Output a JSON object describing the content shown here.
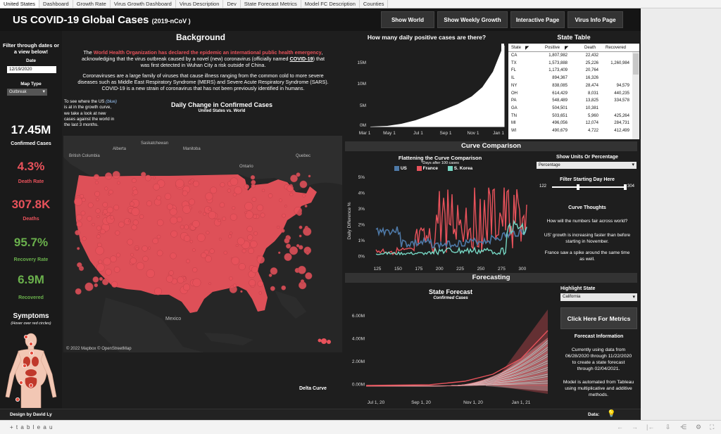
{
  "tabs": [
    "United States",
    "Dashboard",
    "Growth Rate",
    "Virus Growth Dashboard",
    "Virus Description",
    "Dev",
    "State Forecast Metrics",
    "Model FC Description",
    "Counties"
  ],
  "header": {
    "title": "US COVID-19 Global Cases",
    "subtitle": "(2019-nCoV )",
    "buttons": [
      "Show World",
      "Show Weekly Growth",
      "Interactive Page",
      "Virus Info Page"
    ]
  },
  "filters": {
    "heading_line1": "Filter through dates or",
    "heading_line2": "a view below!",
    "date_label": "Date",
    "date_value": "12/19/2020",
    "maptype_label": "Map Type",
    "maptype_value": "Outbreak"
  },
  "kpis": {
    "confirmed_value": "17.45M",
    "confirmed_label": "Confirmed Cases",
    "death_rate_value": "4.3%",
    "death_rate_label": "Death Rate",
    "deaths_value": "307.8K",
    "deaths_label": "Deaths",
    "recovery_rate_value": "95.7%",
    "recovery_rate_label": "Recovery Rate",
    "recovered_value": "6.9M",
    "recovered_label": "Recovered"
  },
  "symptoms": {
    "title": "Symptoms",
    "hint": "(Hover over red circles)"
  },
  "background": {
    "heading": "Background",
    "p1_a": "The ",
    "p1_who": "World Health Organization has declared the epidemic an international public health emergency",
    "p1_b": ",",
    "p1_line2_a": "acknowledging that the virus outbreak caused by a novel (new) coronavirus (officially named ",
    "p1_link": "COVID-19",
    "p1_line2_b": ") that",
    "p1_line3": "was first detected in Wuhan City a risk outside of China.",
    "p2_line1": "Coronaviruses are a large family of viruses that cause illness ranging from the common cold to more severe",
    "p2_line2": "diseases such as Middle East Respiratory Syndrome (MERS) and Severe Acute Respiratory Syndrome (SARS).",
    "p2_line3": "COVID-19 is a new strain of coronavirus that has not been previously identified in humans."
  },
  "growth_note": {
    "line1": "To see where the US ",
    "blue": "(blue)",
    "line2": "is at in the growth curve,",
    "line3": "we take a look at new",
    "line4": "cases against the world in",
    "line5": "the last 3 months."
  },
  "map": {
    "title": "Daily Change in Confirmed Cases",
    "subtitle": "United States vs. World",
    "labels": [
      "Alberta",
      "Saskatchewan",
      "Manitoba",
      "British Columbia",
      "Ontario",
      "Quebec",
      "Mexico"
    ],
    "credit": "© 2022 Mapbox  © OpenStreetMap",
    "delta_label": "Delta Curve"
  },
  "daily_chart": {
    "title": "How many daily positive cases are there?",
    "y_ticks": [
      "15M",
      "10M",
      "5M",
      "0M"
    ],
    "x_ticks": [
      "Mar 1",
      "May 1",
      "Jul 1",
      "Sep 1",
      "Nov 1",
      "Jan 1"
    ]
  },
  "state_table": {
    "title": "State Table",
    "columns": [
      "State",
      "Positive",
      "Death",
      "Recovered"
    ],
    "rows": [
      [
        "CA",
        "1,807,982",
        "22,432",
        ""
      ],
      [
        "TX",
        "1,573,888",
        "25,226",
        "1,260,984"
      ],
      [
        "FL",
        "1,173,409",
        "20,764",
        ""
      ],
      [
        "IL",
        "894,367",
        "16,326",
        ""
      ],
      [
        "NY",
        "838,085",
        "28,474",
        "94,579"
      ],
      [
        "OH",
        "614,429",
        "8,031",
        "440,235"
      ],
      [
        "PA",
        "548,489",
        "13,825",
        "334,578"
      ],
      [
        "GA",
        "504,501",
        "10,381",
        ""
      ],
      [
        "TN",
        "503,651",
        "5,960",
        "425,264"
      ],
      [
        "MI",
        "496,056",
        "12,074",
        "284,731"
      ],
      [
        "WI",
        "490,679",
        "4,722",
        "412,499"
      ]
    ]
  },
  "curve": {
    "section_title": "Curve Comparison",
    "title": "Flattening the Curve Comparison",
    "subtitle": "*Days after 100 cases",
    "legend": [
      "US",
      "France",
      "S. Korea"
    ],
    "y_label": "Daily Difference %",
    "y_ticks": [
      "5%",
      "4%",
      "3%",
      "2%",
      "1%",
      "0%"
    ],
    "x_ticks": [
      "125",
      "150",
      "175",
      "200",
      "225",
      "250",
      "275",
      "300"
    ]
  },
  "controls": {
    "units_label": "Show Units Or Percentage",
    "units_value": "Percentage",
    "day_label": "Filter Starting Day Here",
    "day_min": "122",
    "day_max": "304",
    "thoughts_title": "Curve Thoughts",
    "thought1": "How will the numbers fair across world?",
    "thought2_l1": "US' growth is increasing faster than before",
    "thought2_l2": "starting in November.",
    "thought3_l1": "France saw a spike around the same time",
    "thought3_l2": "as well."
  },
  "forecast": {
    "section_title": "Forecasting",
    "title": "State Forecast",
    "subtitle": "Confirmed Cases",
    "y_ticks": [
      "6.00M",
      "4.00M",
      "2.00M",
      "0.00M"
    ],
    "x_ticks": [
      "Jul 1, 20",
      "Sep 1, 20",
      "Nov 1, 20",
      "Jan 1, 21"
    ],
    "highlight_label": "Highlight State",
    "highlight_value": "California",
    "metrics_button": "Click Here For Metrics",
    "info_title": "Forecast Information",
    "info_l1": "Currently using data from",
    "info_l2": "06/28/2020 through 11/22/2020",
    "info_l3": "to create a state forecast",
    "info_l4": "through 02/04/2021.",
    "model_l1": "Model is automated from Tableau",
    "model_l2": "using multiplicative and additive",
    "model_l3": "methods."
  },
  "footer": {
    "credit": "Design by David Ly",
    "data_label": "Data:"
  },
  "tableau": {
    "logo_text": "+ t a b l e a u"
  },
  "colors": {
    "accent_red": "#e8525b",
    "green": "#6ab04c",
    "blue": "#4e79a7",
    "teal": "#76d7c4"
  }
}
